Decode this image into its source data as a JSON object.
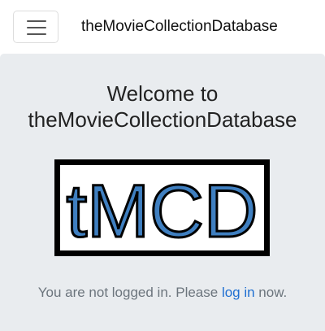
{
  "navbar": {
    "brand": "theMovieCollectionDatabase",
    "toggler_icon": "hamburger-menu-icon"
  },
  "hero": {
    "title_line1": "Welcome to",
    "title_line2": "theMovieCollectionDatabase",
    "logo_text": "tMCD",
    "message_before": "You are not logged in. Please ",
    "login_link": "log in",
    "message_after": " now."
  },
  "colors": {
    "jumbotron_bg": "#e9ecef",
    "link": "#1f6fd1",
    "logo_fill": "#3f7fc0"
  }
}
